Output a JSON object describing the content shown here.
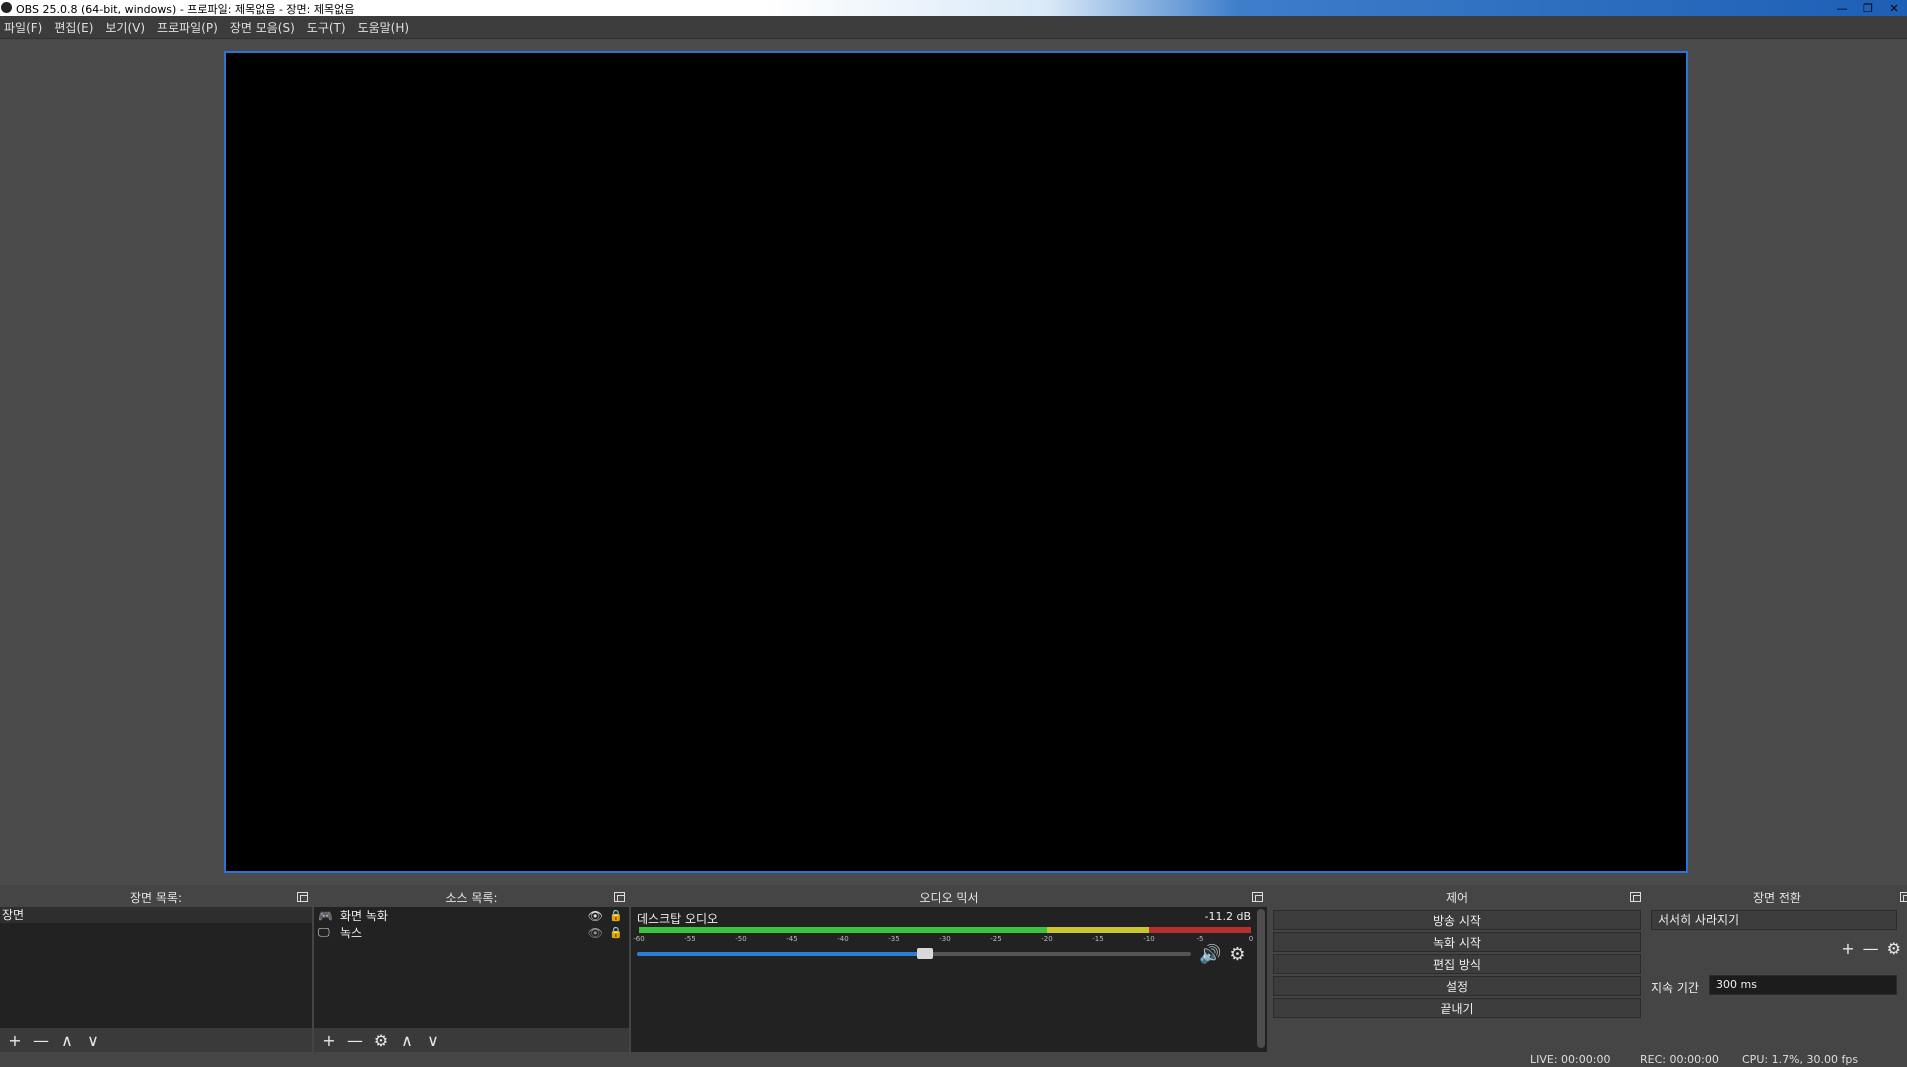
{
  "window": {
    "title": "OBS 25.0.8 (64-bit, windows) - 프로파일: 제목없음 - 장면: 제목없음",
    "minimize": "—",
    "restore": "❐",
    "close": "✕"
  },
  "menu": [
    "파일(F)",
    "편집(E)",
    "보기(V)",
    "프로파일(P)",
    "장면 모음(S)",
    "도구(T)",
    "도움말(H)"
  ],
  "scenes_dock": {
    "title": "장면 목록:",
    "items": [
      "장면"
    ],
    "toolbar": [
      "+",
      "—",
      "∧",
      "∨"
    ]
  },
  "sources_dock": {
    "title": "소스 목록:",
    "items": [
      {
        "label": "화면 녹화",
        "icon": "game-capture-icon",
        "visible": true
      },
      {
        "label": "녹스",
        "icon": "monitor-icon",
        "visible": false
      }
    ],
    "toolbar": [
      "+",
      "—",
      "⚙",
      "∧",
      "∨"
    ]
  },
  "mixer_dock": {
    "title": "오디오 믹서",
    "channel_name": "데스크탑 오디오",
    "level": "-11.2 dB",
    "meter_ticks": [
      "-60",
      "-55",
      "-50",
      "-45",
      "-40",
      "-35",
      "-30",
      "-25",
      "-20",
      "-15",
      "-10",
      "-5",
      "0"
    ],
    "volume_fraction": 0.52
  },
  "controls_dock": {
    "title": "제어",
    "buttons": [
      "방송 시작",
      "녹화 시작",
      "편집 방식",
      "설정",
      "끝내기"
    ]
  },
  "transitions_dock": {
    "title": "장면 전환",
    "selected": "서서히 사라지기",
    "duration_label": "지속 기간",
    "duration_value": "300 ms"
  },
  "status": {
    "live": "LIVE: 00:00:00",
    "rec": "REC: 00:00:00",
    "cpu": "CPU: 1.7%, 30.00 fps"
  },
  "colors": {
    "preview_border": "#2a74d6",
    "meter_green": "#3cc43c",
    "meter_yellow": "#c9c830",
    "meter_red": "#b63030",
    "volume_fill": "#2d7ed8"
  }
}
